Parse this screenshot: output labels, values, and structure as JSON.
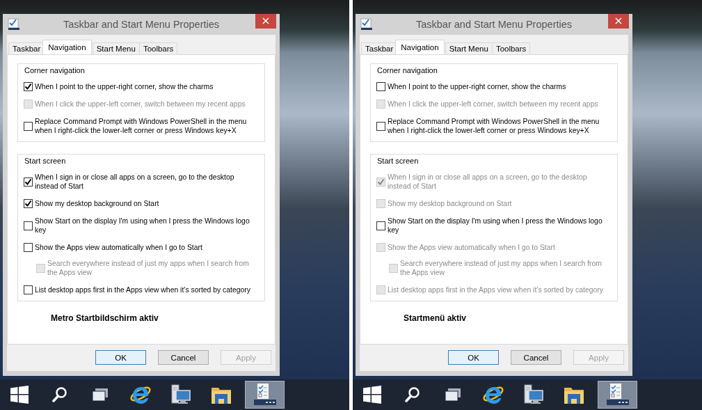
{
  "panels": [
    {
      "window": {
        "title": "Taskbar and Start Menu Properties",
        "close": "×"
      },
      "tabs": [
        {
          "label": "Taskbar",
          "selected": false
        },
        {
          "label": "Navigation",
          "selected": true
        },
        {
          "label": "Start Menu",
          "selected": false
        },
        {
          "label": "Toolbars",
          "selected": false
        }
      ],
      "groups": [
        {
          "title": "Corner navigation",
          "options": [
            {
              "label": "When I point to the upper-right corner, show the charms",
              "checked": true,
              "disabled": false
            },
            {
              "label": "When I click the upper-left corner, switch between my recent apps",
              "checked": false,
              "disabled": true
            },
            {
              "label": "Replace Command Prompt with Windows PowerShell in the menu when I right-click the lower-left corner or press Windows key+X",
              "checked": false,
              "disabled": false
            }
          ]
        },
        {
          "title": "Start screen",
          "options": [
            {
              "label": "When I sign in or close all apps on a screen, go to the desktop instead of Start",
              "checked": true,
              "disabled": false
            },
            {
              "label": "Show my desktop background on Start",
              "checked": true,
              "disabled": false
            },
            {
              "label": "Show Start on the display I'm using when I press the Windows logo key",
              "checked": false,
              "disabled": false
            },
            {
              "label": "Show the Apps view automatically when I go to Start",
              "checked": false,
              "disabled": false,
              "children": [
                {
                  "label": "Search everywhere instead of just my apps when I search from the Apps view",
                  "checked": false,
                  "disabled": true
                }
              ]
            },
            {
              "label": "List desktop apps first in the Apps view when it’s sorted by category",
              "checked": false,
              "disabled": false
            }
          ]
        }
      ],
      "caption": "Metro Startbildschirm aktiv",
      "buttons": [
        {
          "label": "OK",
          "kind": "default",
          "disabled": false
        },
        {
          "label": "Cancel",
          "kind": "normal",
          "disabled": false
        },
        {
          "label": "Apply",
          "kind": "normal",
          "disabled": true
        }
      ],
      "taskbar": [
        {
          "kind": "start",
          "selected": false
        },
        {
          "kind": "search",
          "selected": false
        },
        {
          "kind": "taskview",
          "selected": false
        },
        {
          "kind": "browser",
          "selected": false
        },
        {
          "kind": "network",
          "selected": false
        },
        {
          "kind": "folder",
          "selected": false
        },
        {
          "kind": "properties",
          "selected": true
        }
      ]
    },
    {
      "window": {
        "title": "Taskbar and Start Menu Properties",
        "close": "×"
      },
      "tabs": [
        {
          "label": "Taskbar",
          "selected": false
        },
        {
          "label": "Navigation",
          "selected": true
        },
        {
          "label": "Start Menu",
          "selected": false
        },
        {
          "label": "Toolbars",
          "selected": false
        }
      ],
      "groups": [
        {
          "title": "Corner navigation",
          "options": [
            {
              "label": "When I point to the upper-right corner, show the charms",
              "checked": false,
              "disabled": false
            },
            {
              "label": "When I click the upper-left corner, switch between my recent apps",
              "checked": false,
              "disabled": true
            },
            {
              "label": "Replace Command Prompt with Windows PowerShell in the menu when I right-click the lower-left corner or press Windows key+X",
              "checked": false,
              "disabled": false
            }
          ]
        },
        {
          "title": "Start screen",
          "options": [
            {
              "label": "When I sign in or close all apps on a screen, go to the desktop instead of Start",
              "checked": true,
              "disabled": true
            },
            {
              "label": "Show my desktop background on Start",
              "checked": false,
              "disabled": true
            },
            {
              "label": "Show Start on the display I'm using when I press the Windows logo key",
              "checked": false,
              "disabled": false
            },
            {
              "label": "Show the Apps view automatically when I go to Start",
              "checked": false,
              "disabled": true,
              "children": [
                {
                  "label": "Search everywhere instead of just my apps when I search from the Apps view",
                  "checked": false,
                  "disabled": true
                }
              ]
            },
            {
              "label": "List desktop apps first in the Apps view when it’s sorted by category",
              "checked": false,
              "disabled": true
            }
          ]
        }
      ],
      "caption": "Startmenü aktiv",
      "buttons": [
        {
          "label": "OK",
          "kind": "default",
          "disabled": false
        },
        {
          "label": "Cancel",
          "kind": "normal",
          "disabled": false
        },
        {
          "label": "Apply",
          "kind": "normal",
          "disabled": true
        }
      ],
      "taskbar": [
        {
          "kind": "start",
          "selected": false
        },
        {
          "kind": "search",
          "selected": false
        },
        {
          "kind": "taskview",
          "selected": false
        },
        {
          "kind": "browser",
          "selected": false
        },
        {
          "kind": "network",
          "selected": false
        },
        {
          "kind": "folder",
          "selected": false
        },
        {
          "kind": "properties",
          "selected": true
        }
      ]
    }
  ]
}
